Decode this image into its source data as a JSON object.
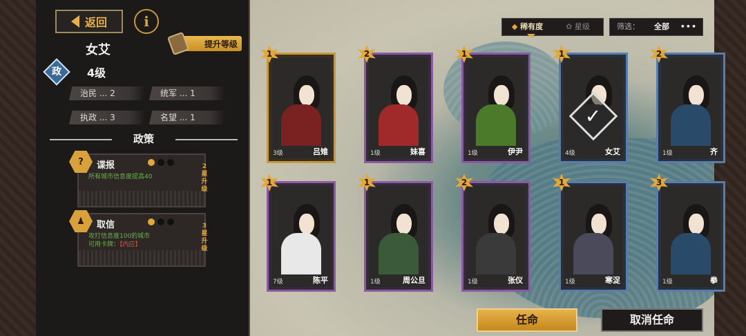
{
  "left_panel": {
    "back_label": "返回",
    "info_label": "i",
    "upgrade_label": "提升等级",
    "character_name": "女艾",
    "attribute_icon": "政",
    "level": "4级",
    "stats": [
      {
        "label": "治民 ... 2"
      },
      {
        "label": "统军 ... 1"
      },
      {
        "label": "执政 ... 3"
      },
      {
        "label": "名望 ... 1"
      }
    ],
    "section_title": "政策",
    "policies": [
      {
        "icon": "?",
        "name": "谍报",
        "desc_line1": "所有城市信息度提高40",
        "desc_line2": "",
        "desc_red": "",
        "upgrade_note": "2星升级",
        "dots_on": 1
      },
      {
        "icon": "♟",
        "name": "取信",
        "desc_line1": "攻打信息度100的城市",
        "desc_line2": "可用卡牌：",
        "desc_red": "【内应】",
        "upgrade_note": "3星升级",
        "dots_on": 1
      }
    ]
  },
  "controls": {
    "sort_rarity": "稀有度",
    "sort_star": "星级",
    "filter_label": "筛选：",
    "filter_value": "全部",
    "more": "•••"
  },
  "cards": [
    {
      "name": "吕雉",
      "level": "3级",
      "stars": "1",
      "frame": "gold",
      "selected": false
    },
    {
      "name": "妹喜",
      "level": "1级",
      "stars": "2",
      "frame": "purple",
      "selected": false
    },
    {
      "name": "伊尹",
      "level": "1级",
      "stars": "1",
      "frame": "purple",
      "selected": false
    },
    {
      "name": "女艾",
      "level": "4级",
      "stars": "1",
      "frame": "blue",
      "selected": true
    },
    {
      "name": "齐",
      "level": "1级",
      "stars": "2",
      "frame": "blue",
      "selected": false
    },
    {
      "name": "陈平",
      "level": "7级",
      "stars": "1",
      "frame": "purple",
      "selected": false
    },
    {
      "name": "周公旦",
      "level": "1级",
      "stars": "1",
      "frame": "purple",
      "selected": false
    },
    {
      "name": "张仪",
      "level": "1级",
      "stars": "2",
      "frame": "purple",
      "selected": false
    },
    {
      "name": "寒浞",
      "level": "1级",
      "stars": "1",
      "frame": "blue",
      "selected": false
    },
    {
      "name": "拳",
      "level": "1级",
      "stars": "3",
      "frame": "blue",
      "selected": false
    }
  ],
  "buttons": {
    "appoint": "任命",
    "cancel": "取消任命"
  }
}
